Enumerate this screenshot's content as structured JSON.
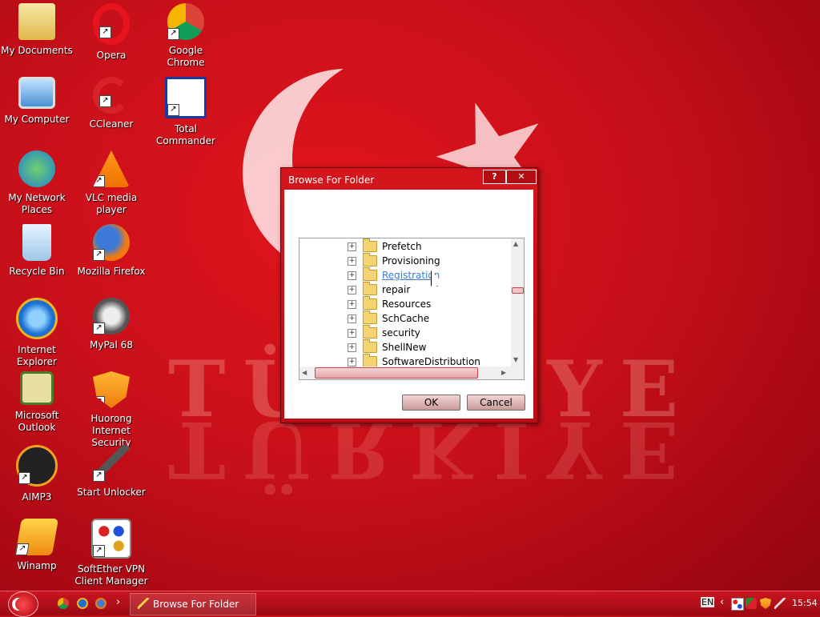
{
  "desktop_icons": [
    {
      "label": "My Documents",
      "icon": "folder-documents-icon",
      "shortcut": false
    },
    {
      "label": "Opera",
      "icon": "opera-icon",
      "shortcut": true
    },
    {
      "label": "Google Chrome",
      "icon": "chrome-icon",
      "shortcut": true
    },
    {
      "label": "My Computer",
      "icon": "computer-icon",
      "shortcut": false
    },
    {
      "label": "CCleaner",
      "icon": "ccleaner-icon",
      "shortcut": true
    },
    {
      "label": "Total Commander",
      "icon": "floppy-icon",
      "shortcut": true
    },
    {
      "label": "My Network Places",
      "icon": "network-icon",
      "shortcut": false
    },
    {
      "label": "VLC media player",
      "icon": "vlc-cone-icon",
      "shortcut": true
    },
    {
      "label": "Recycle Bin",
      "icon": "recycle-bin-icon",
      "shortcut": false
    },
    {
      "label": "Mozilla Firefox",
      "icon": "firefox-icon",
      "shortcut": true
    },
    {
      "label": "Internet Explorer",
      "icon": "ie-icon",
      "shortcut": false
    },
    {
      "label": "MyPal 68",
      "icon": "raccoon-icon",
      "shortcut": true
    },
    {
      "label": "Microsoft Outlook",
      "icon": "outlook-icon",
      "shortcut": false
    },
    {
      "label": "Huorong Internet Security",
      "icon": "shield-flame-icon",
      "shortcut": true
    },
    {
      "label": "AIMP3",
      "icon": "aimp-icon",
      "shortcut": true
    },
    {
      "label": "Start Unlocker",
      "icon": "magic-wand-icon",
      "shortcut": true
    },
    {
      "label": "Winamp",
      "icon": "winamp-icon",
      "shortcut": true
    },
    {
      "label": "SoftEther VPN Client Manager",
      "icon": "softether-icon",
      "shortcut": true
    }
  ],
  "wallpaper": {
    "text": "TÜRKIYE"
  },
  "dialog": {
    "title": "Browse For Folder",
    "help_label": "?",
    "close_label": "✕",
    "folders": [
      {
        "name": "Prefetch"
      },
      {
        "name": "Provisioning"
      },
      {
        "name": "Registration",
        "hover": true
      },
      {
        "name": "repair"
      },
      {
        "name": "Resources"
      },
      {
        "name": "SchCache"
      },
      {
        "name": "security"
      },
      {
        "name": "ShellNew"
      },
      {
        "name": "SoftwareDistribution"
      }
    ],
    "ok_label": "OK",
    "cancel_label": "Cancel"
  },
  "taskbar": {
    "task_label": "Browse For Folder",
    "lang": "EN",
    "clock": "15:54",
    "expand_glyph": "›",
    "tray_expand_glyph": "‹"
  },
  "colors": {
    "accent": "#c8101a",
    "hover_link": "#3a7bd5"
  }
}
